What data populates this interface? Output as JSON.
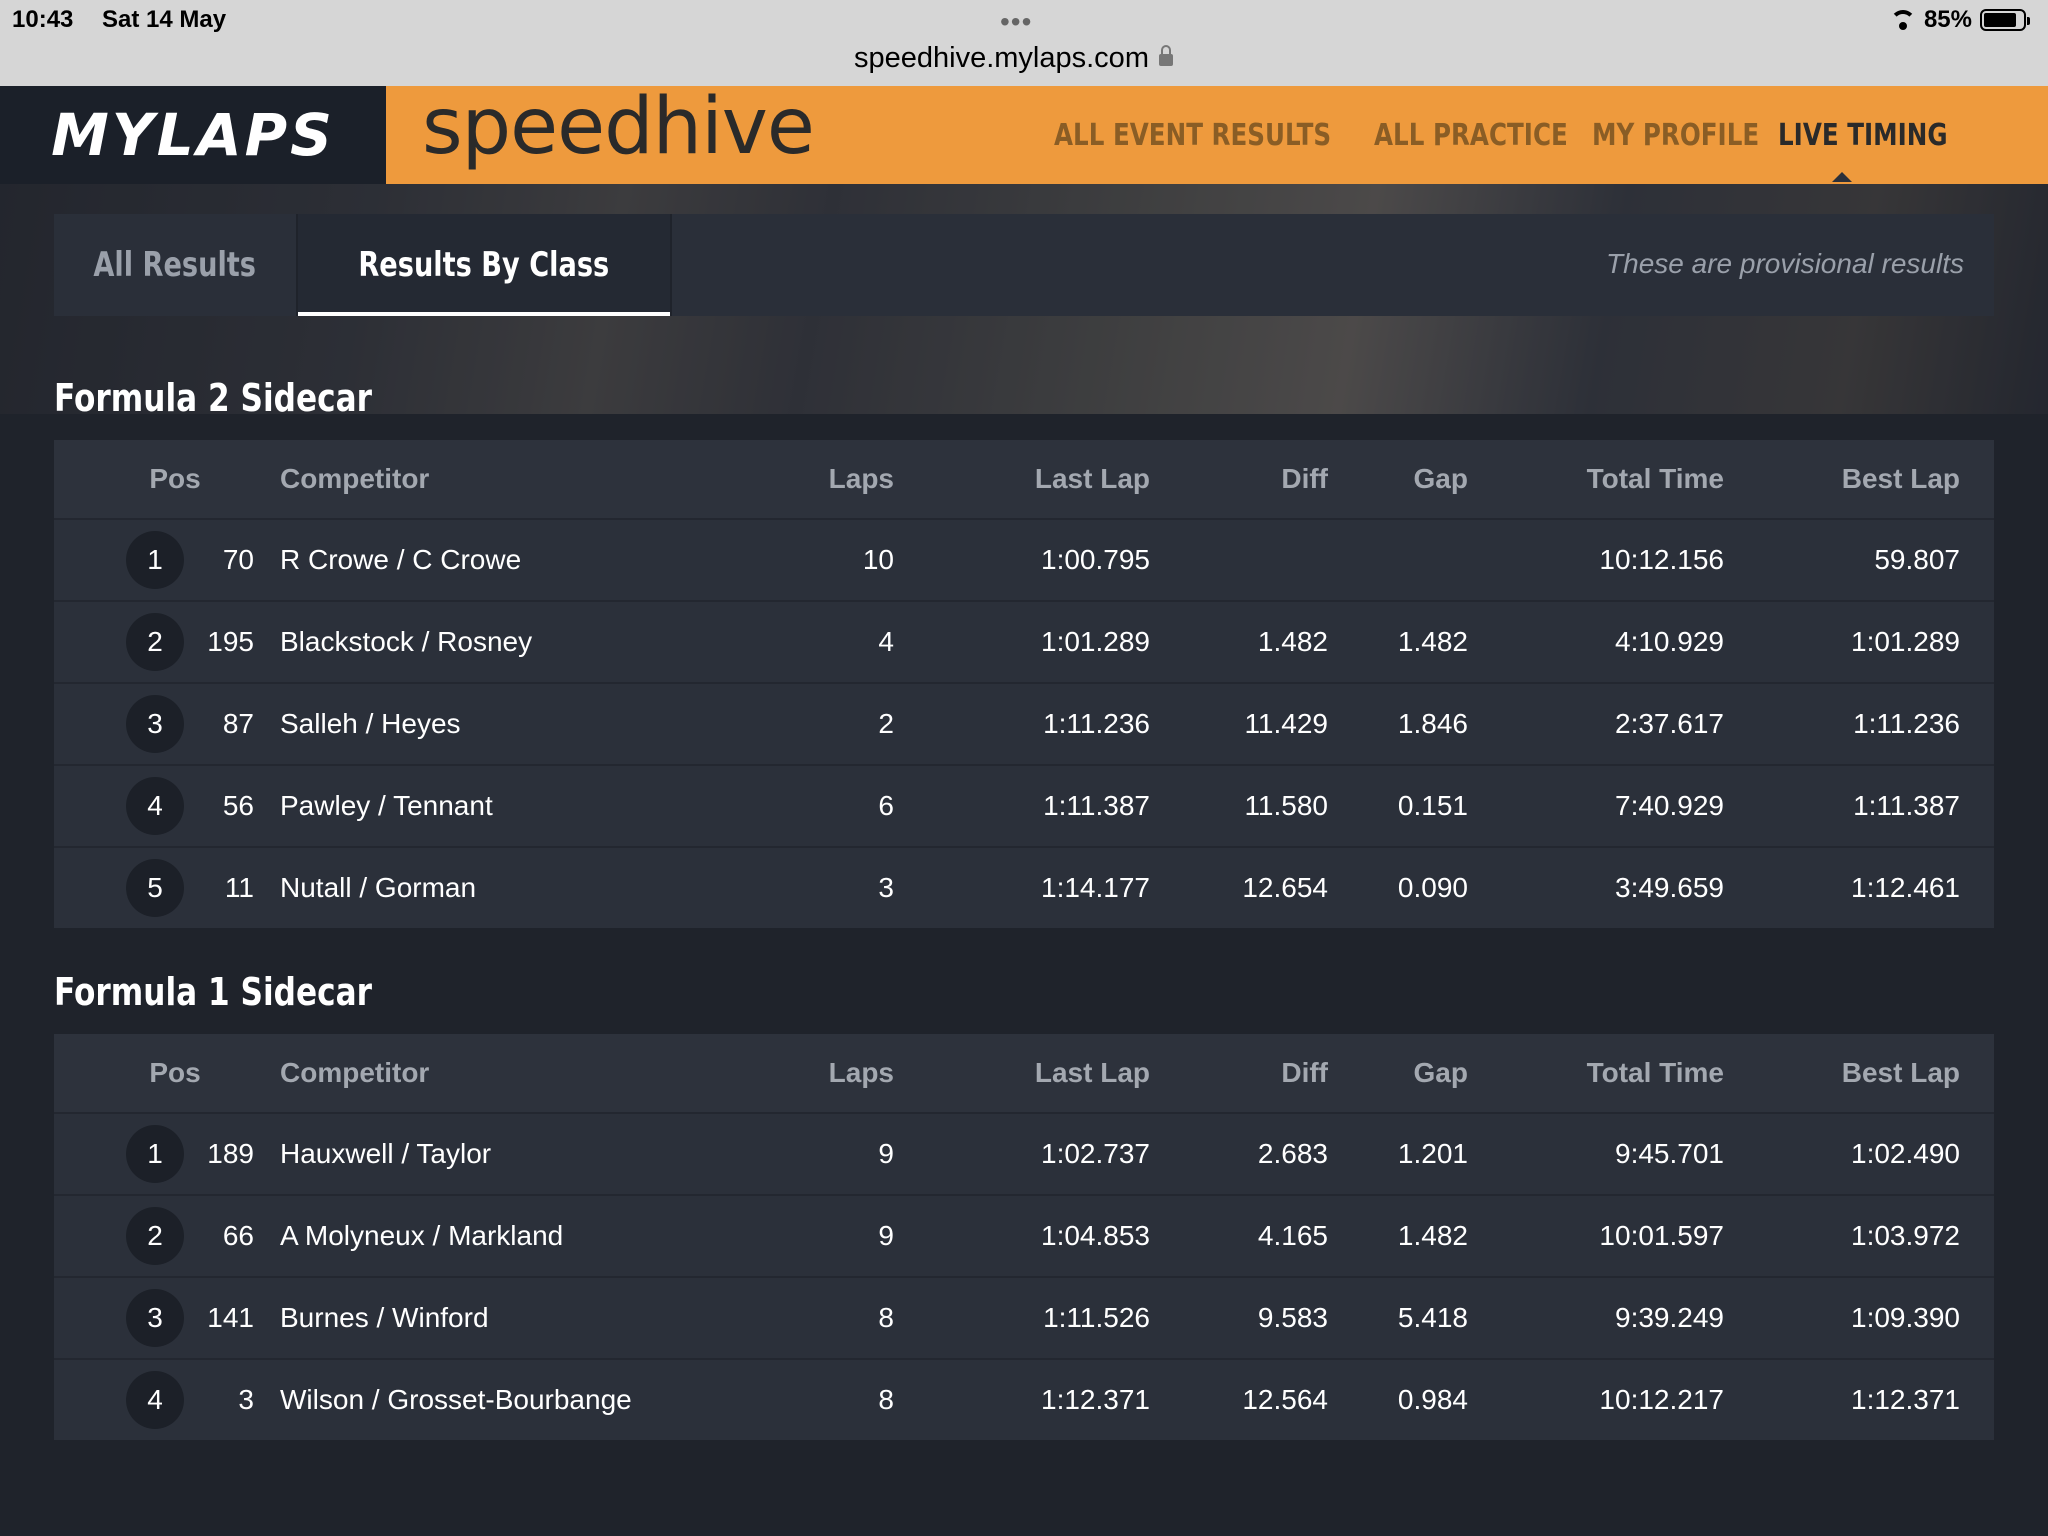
{
  "status_bar": {
    "time": "10:43",
    "date": "Sat 14 May",
    "dots": "•••",
    "url": "speedhive.mylaps.com",
    "battery": "85%",
    "battery_level": 0.85
  },
  "header": {
    "brand": "MYLAPS",
    "product": "speedhive",
    "nav": [
      {
        "label": "ALL EVENT RESULTS",
        "active": false
      },
      {
        "label": "ALL PRACTICE",
        "active": false
      },
      {
        "label": "MY PROFILE",
        "active": false
      },
      {
        "label": "LIVE TIMING",
        "active": true
      }
    ],
    "accent_color": "#ee9a3d"
  },
  "tabs": {
    "all_results": "All Results",
    "results_by_class": "Results By Class",
    "notice": "These are provisional results"
  },
  "columns": {
    "pos": "Pos",
    "competitor": "Competitor",
    "laps": "Laps",
    "last_lap": "Last Lap",
    "diff": "Diff",
    "gap": "Gap",
    "total_time": "Total Time",
    "best_lap": "Best Lap"
  },
  "classes": [
    {
      "title": "Formula 2 Sidecar",
      "rows": [
        {
          "pos": "1",
          "num": "70",
          "competitor": "R Crowe / C Crowe",
          "laps": "10",
          "last_lap": "1:00.795",
          "diff": "",
          "gap": "",
          "total_time": "10:12.156",
          "best_lap": "59.807"
        },
        {
          "pos": "2",
          "num": "195",
          "competitor": "Blackstock / Rosney",
          "laps": "4",
          "last_lap": "1:01.289",
          "diff": "1.482",
          "gap": "1.482",
          "total_time": "4:10.929",
          "best_lap": "1:01.289"
        },
        {
          "pos": "3",
          "num": "87",
          "competitor": "Salleh / Heyes",
          "laps": "2",
          "last_lap": "1:11.236",
          "diff": "11.429",
          "gap": "1.846",
          "total_time": "2:37.617",
          "best_lap": "1:11.236"
        },
        {
          "pos": "4",
          "num": "56",
          "competitor": "Pawley / Tennant",
          "laps": "6",
          "last_lap": "1:11.387",
          "diff": "11.580",
          "gap": "0.151",
          "total_time": "7:40.929",
          "best_lap": "1:11.387"
        },
        {
          "pos": "5",
          "num": "11",
          "competitor": "Nutall / Gorman",
          "laps": "3",
          "last_lap": "1:14.177",
          "diff": "12.654",
          "gap": "0.090",
          "total_time": "3:49.659",
          "best_lap": "1:12.461"
        }
      ]
    },
    {
      "title": "Formula 1 Sidecar",
      "rows": [
        {
          "pos": "1",
          "num": "189",
          "competitor": "Hauxwell / Taylor",
          "laps": "9",
          "last_lap": "1:02.737",
          "diff": "2.683",
          "gap": "1.201",
          "total_time": "9:45.701",
          "best_lap": "1:02.490"
        },
        {
          "pos": "2",
          "num": "66",
          "competitor": "A Molyneux / Markland",
          "laps": "9",
          "last_lap": "1:04.853",
          "diff": "4.165",
          "gap": "1.482",
          "total_time": "10:01.597",
          "best_lap": "1:03.972"
        },
        {
          "pos": "3",
          "num": "141",
          "competitor": "Burnes / Winford",
          "laps": "8",
          "last_lap": "1:11.526",
          "diff": "9.583",
          "gap": "5.418",
          "total_time": "9:39.249",
          "best_lap": "1:09.390"
        },
        {
          "pos": "4",
          "num": "3",
          "competitor": "Wilson / Grosset-Bourbange",
          "laps": "8",
          "last_lap": "1:12.371",
          "diff": "12.564",
          "gap": "0.984",
          "total_time": "10:12.217",
          "best_lap": "1:12.371"
        }
      ]
    }
  ]
}
